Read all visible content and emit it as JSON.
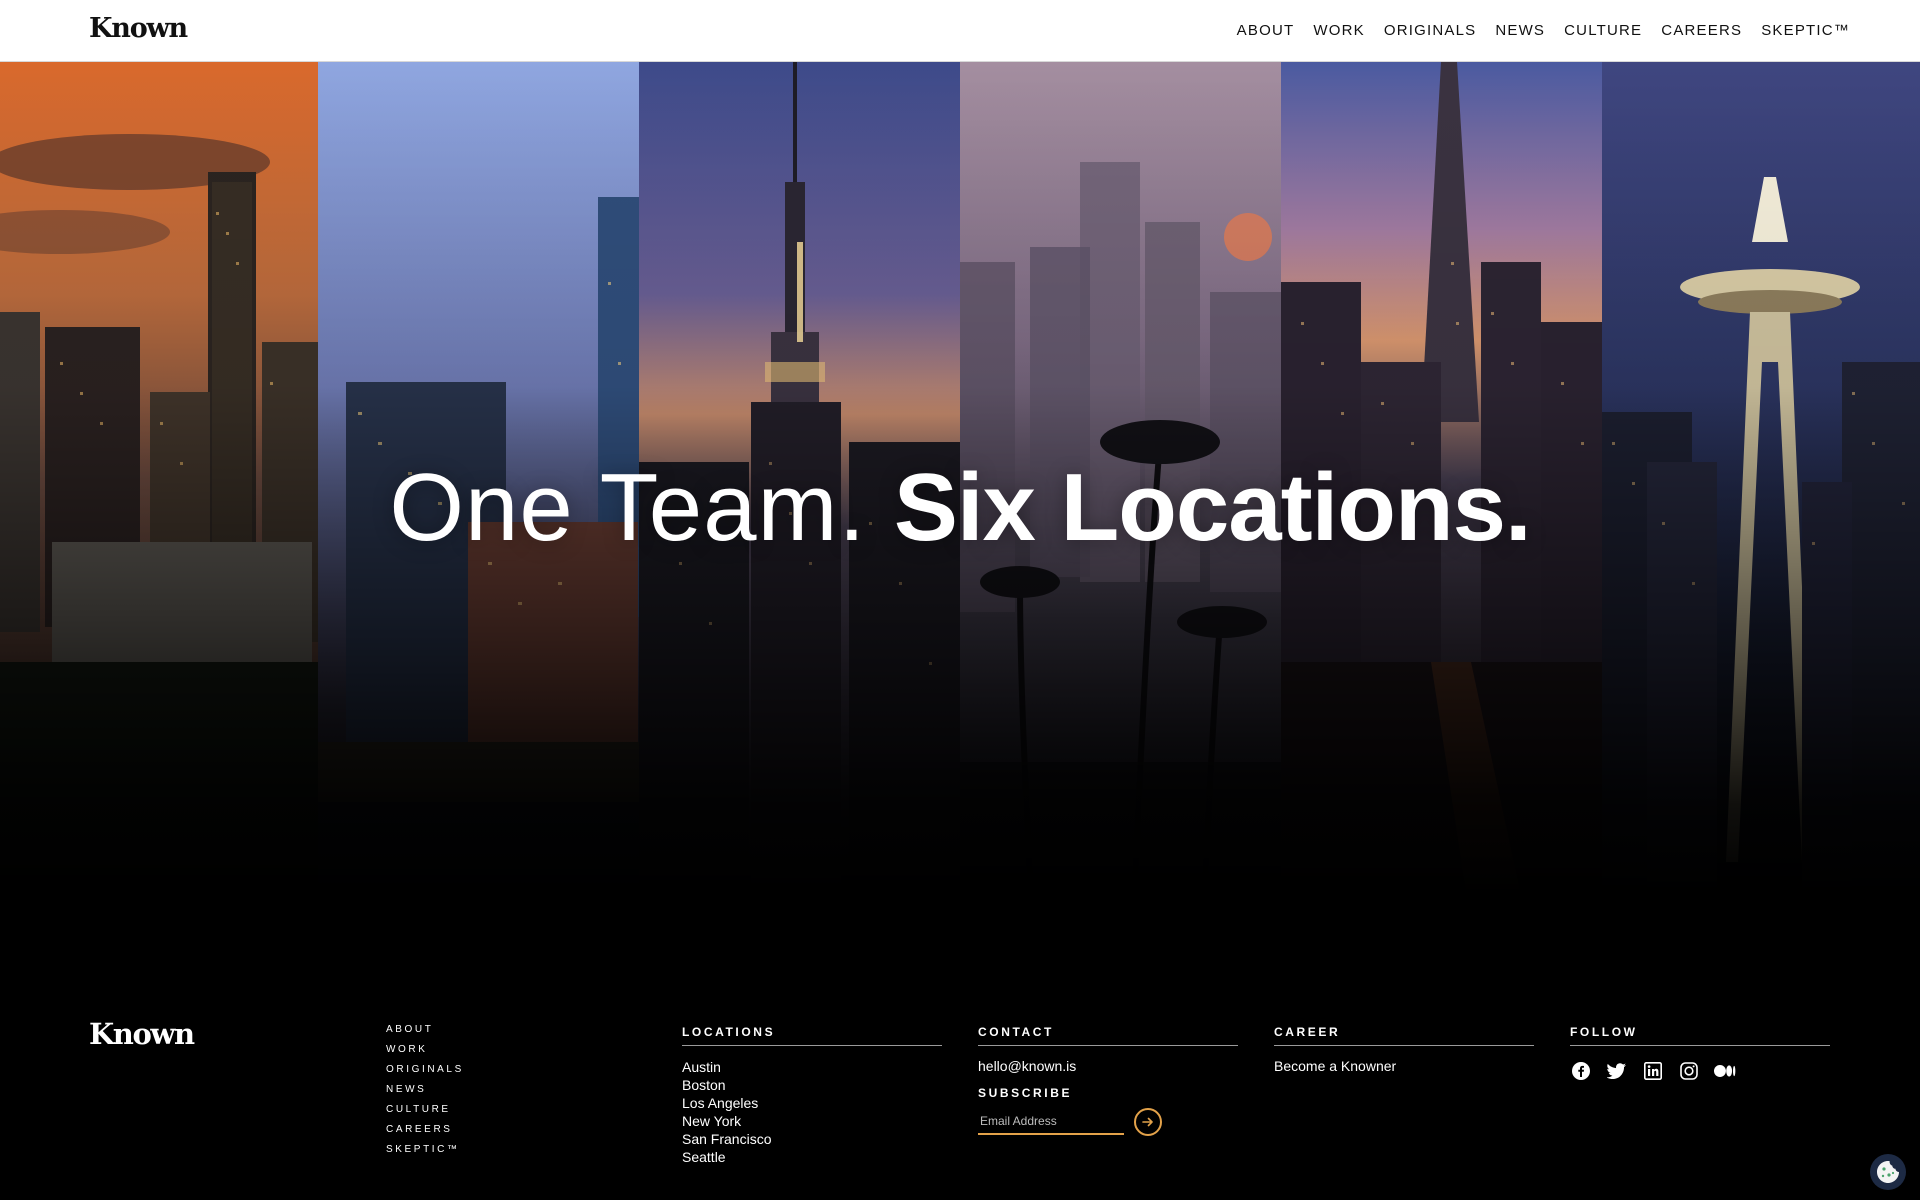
{
  "header": {
    "brand": "Known",
    "nav": [
      "ABOUT",
      "WORK",
      "ORIGINALS",
      "NEWS",
      "CULTURE",
      "CAREERS",
      "SKEPTIC™"
    ]
  },
  "hero": {
    "headline_light": "One Team. ",
    "headline_bold": "Six Locations."
  },
  "footer": {
    "brand": "Known",
    "nav": [
      "ABOUT",
      "WORK",
      "ORIGINALS",
      "NEWS",
      "CULTURE",
      "CAREERS",
      "SKEPTIC™"
    ],
    "locations": {
      "title": "LOCATIONS",
      "items": [
        "Austin",
        "Boston",
        "Los Angeles",
        "New York",
        "San Francisco",
        "Seattle"
      ]
    },
    "contact": {
      "title": "CONTACT",
      "email": "hello@known.is",
      "subscribe_title": "SUBSCRIBE",
      "email_placeholder": "Email Address"
    },
    "career": {
      "title": "CAREER",
      "link": "Become a Knowner"
    },
    "follow": {
      "title": "FOLLOW",
      "icons": [
        "facebook-icon",
        "twitter-icon",
        "linkedin-icon",
        "instagram-icon",
        "medium-icon"
      ]
    }
  },
  "colors": {
    "accent": "#e3a24a",
    "background": "#000000",
    "header_bg": "#ffffff"
  }
}
